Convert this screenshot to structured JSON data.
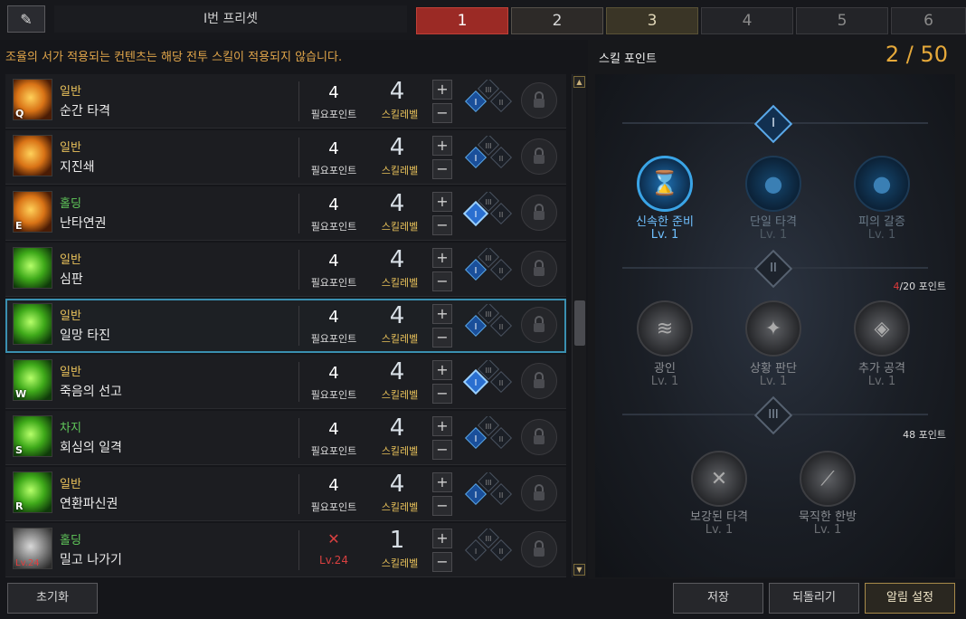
{
  "preset": {
    "name": "I번 프리셋",
    "tabs": [
      "1",
      "2",
      "3",
      "4",
      "5",
      "6"
    ]
  },
  "notice": "조율의 서가 적용되는 컨텐츠는 해당 전투 스킬이 적용되지 않습니다.",
  "labels": {
    "required_points": "필요포인트",
    "skill_level": "스킬레벨"
  },
  "skills": [
    {
      "type": "일반",
      "name": "순간 타격",
      "key": "Q",
      "points": "4",
      "level": "4",
      "color": "orange"
    },
    {
      "type": "일반",
      "name": "지진쇄",
      "key": "",
      "points": "4",
      "level": "4",
      "color": "orange"
    },
    {
      "type": "홀딩",
      "name": "난타연권",
      "key": "E",
      "points": "4",
      "level": "4",
      "color": "orange"
    },
    {
      "type": "일반",
      "name": "심판",
      "key": "",
      "points": "4",
      "level": "4",
      "color": "green"
    },
    {
      "type": "일반",
      "name": "일망 타진",
      "key": "",
      "points": "4",
      "level": "4",
      "color": "green"
    },
    {
      "type": "일반",
      "name": "죽음의 선고",
      "key": "W",
      "points": "4",
      "level": "4",
      "color": "green"
    },
    {
      "type": "차지",
      "name": "회심의 일격",
      "key": "S",
      "points": "4",
      "level": "4",
      "color": "green"
    },
    {
      "type": "일반",
      "name": "연환파신권",
      "key": "R",
      "points": "4",
      "level": "4",
      "color": "green"
    },
    {
      "type": "홀딩",
      "name": "밀고 나가기",
      "key": "Lv.24",
      "points": "Lv.24",
      "level": "1",
      "color": "gray"
    }
  ],
  "skill_points": {
    "title": "스킬 포인트",
    "value": "2 / 50"
  },
  "tree": {
    "tier1": [
      {
        "name": "신속한 준비",
        "lv": "Lv. 1"
      },
      {
        "name": "단일 타격",
        "lv": "Lv. 1"
      },
      {
        "name": "피의 갈증",
        "lv": "Lv. 1"
      }
    ],
    "tier2_note_red": "4",
    "tier2_note": "/20 포인트",
    "tier2": [
      {
        "name": "광인",
        "lv": "Lv. 1"
      },
      {
        "name": "상황 판단",
        "lv": "Lv. 1"
      },
      {
        "name": "추가 공격",
        "lv": "Lv. 1"
      }
    ],
    "tier3_note": "48 포인트",
    "tier3": [
      {
        "name": "보강된 타격",
        "lv": "Lv. 1"
      },
      {
        "name": "묵직한 한방",
        "lv": "Lv. 1"
      }
    ],
    "roman": [
      "I",
      "II",
      "III"
    ]
  },
  "buttons": {
    "reset": "초기화",
    "save": "저장",
    "revert": "되돌리기",
    "alert": "알림 설정"
  }
}
